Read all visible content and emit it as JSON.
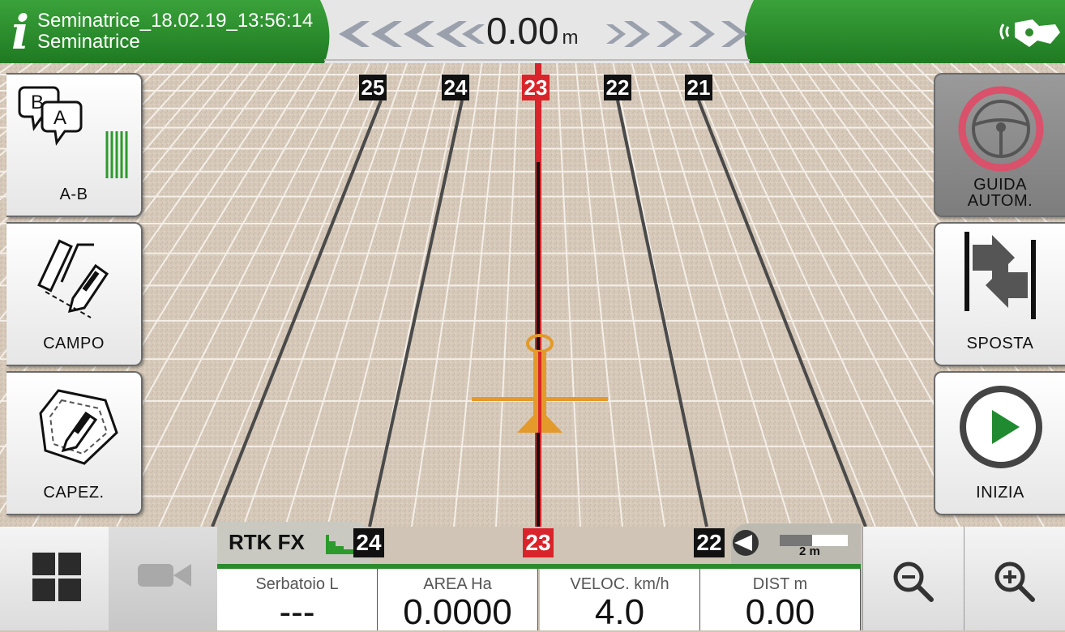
{
  "header": {
    "job_name": "Seminatrice_18.02.19_13:56:14",
    "implement_name": "Seminatrice",
    "offset_value": "0.00",
    "offset_unit": "m",
    "colors": {
      "bar": "#2e8b2e",
      "panel": "#e4e4e4",
      "arrows": "#9aa1ad"
    }
  },
  "left_buttons": [
    {
      "label": "A-B",
      "icon": "ab-line-icon"
    },
    {
      "label": "CAMPO",
      "icon": "field-draw-icon"
    },
    {
      "label": "CAPEZ.",
      "icon": "headland-icon"
    }
  ],
  "right_buttons": [
    {
      "label_line1": "GUIDA",
      "label_line2": "AUTOM.",
      "icon": "steering-wheel-icon",
      "active": false
    },
    {
      "label": "SPOSTA",
      "icon": "shift-line-icon"
    },
    {
      "label": "INIZIA",
      "icon": "play-icon"
    }
  ],
  "guide_rows_top": [
    "25",
    "24",
    "23",
    "22",
    "21"
  ],
  "active_row": "23",
  "status": {
    "rtk": "RTK FX",
    "row_left": "24",
    "row_center": "23",
    "row_right": "22",
    "scale": "2 m"
  },
  "metrics": [
    {
      "label": "Serbatoio L",
      "value": "---"
    },
    {
      "label": "AREA Ha",
      "value": "0.0000"
    },
    {
      "label": "VELOC. km/h",
      "value": "4.0"
    },
    {
      "label": "DIST m",
      "value": "0.00"
    }
  ],
  "bottom_buttons": {
    "menu": "grid-menu-icon",
    "camera": "camera-icon",
    "zoom_out": "zoom-out-icon",
    "zoom_in": "zoom-in-icon"
  }
}
